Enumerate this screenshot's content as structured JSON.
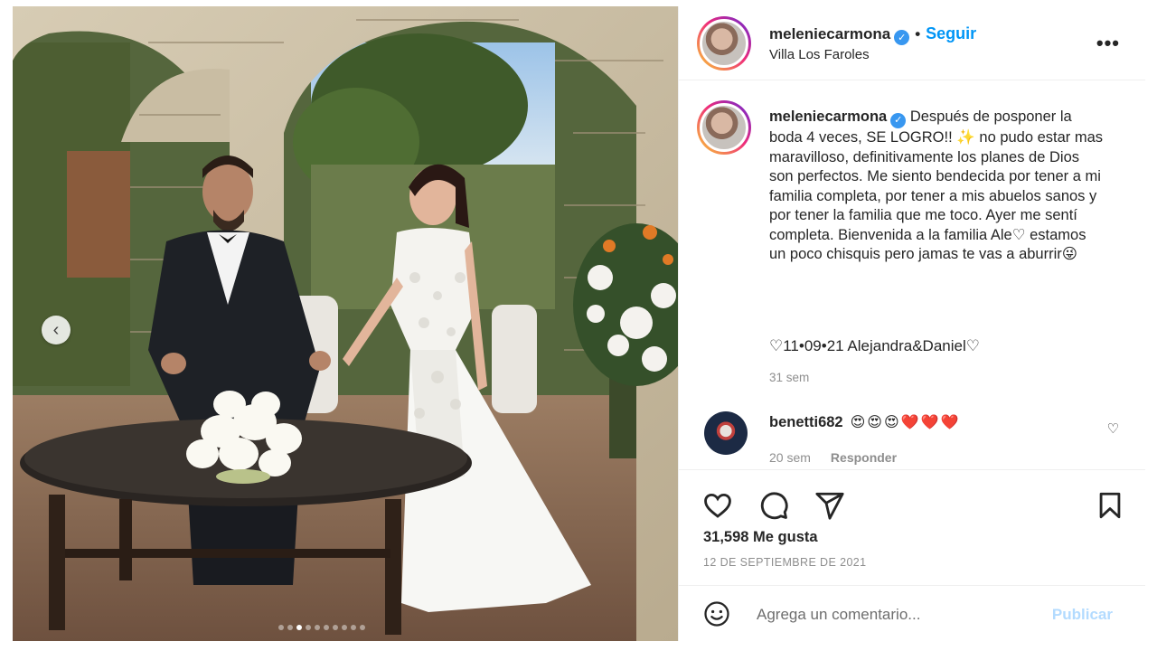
{
  "post": {
    "username": "meleniecarmona",
    "follow_label": "Seguir",
    "location": "Villa Los Faroles",
    "more_label": "•••",
    "caption_text": "Después de posponer la boda 4 veces, SE LOGRO!! ✨ no pudo estar mas maravilloso, definitivamente los planes de Dios son perfectos. Me siento bendecida por tener a mi familia completa, por tener a mis abuelos sanos y por tener la familia que me toco. Ayer me sentí completa. Bienvenida a la familia Ale♡ estamos un poco chisquis pero jamas te vas a aburrir😜",
    "dateline": "♡11•09•21 Alejandra&Daniel♡",
    "caption_age": "31 sem",
    "likes": "31,598 Me gusta",
    "date": "12 DE SEPTIEMBRE DE 2021",
    "carousel_count": 10,
    "carousel_active": 3
  },
  "comment": {
    "username": "benetti682",
    "text": "😍😍😍❤️❤️❤️",
    "age": "20 sem",
    "reply_label": "Responder"
  },
  "composer": {
    "placeholder": "Agrega un comentario...",
    "publish_label": "Publicar"
  },
  "icons": {
    "like": "heart-icon",
    "comment": "comment-bubble-icon",
    "share": "paper-plane-icon",
    "save": "bookmark-icon",
    "emoji": "smiley-icon",
    "carousel_prev": "chevron-left-icon"
  },
  "colors": {
    "follow": "#0095f6",
    "verified": "#3897f0",
    "publish_disabled": "#b3dbff",
    "muted": "#8e8e8e"
  }
}
